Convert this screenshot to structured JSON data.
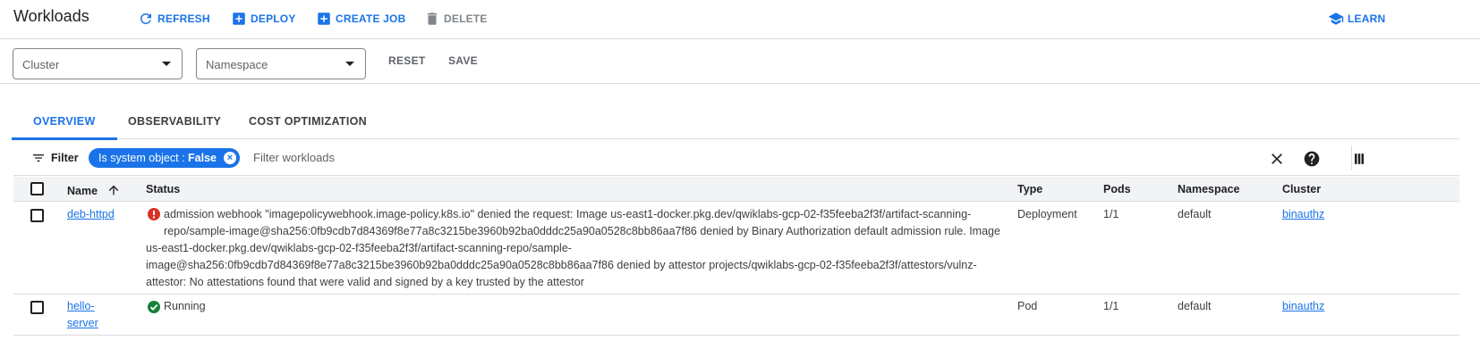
{
  "header": {
    "title": "Workloads",
    "refresh_label": "REFRESH",
    "deploy_label": "DEPLOY",
    "create_job_label": "CREATE JOB",
    "delete_label": "DELETE",
    "learn_label": "LEARN"
  },
  "filters": {
    "cluster_placeholder": "Cluster",
    "namespace_placeholder": "Namespace",
    "reset_label": "RESET",
    "save_label": "SAVE"
  },
  "tabs": [
    {
      "label": "OVERVIEW",
      "active": true
    },
    {
      "label": "OBSERVABILITY",
      "active": false
    },
    {
      "label": "COST OPTIMIZATION",
      "active": false
    }
  ],
  "filterbar": {
    "filter_label": "Filter",
    "chip_key": "Is system object : ",
    "chip_value": "False",
    "input_placeholder": "Filter workloads"
  },
  "table": {
    "columns": {
      "name": "Name",
      "status": "Status",
      "type": "Type",
      "pods": "Pods",
      "namespace": "Namespace",
      "cluster": "Cluster"
    },
    "rows": [
      {
        "name_line1": "deb-httpd",
        "name_line2": "",
        "status_lines": [
          "admission webhook \"imagepolicywebhook.image-policy.k8s.io\" denied the request: Image us-east1-docker.pkg.dev/qwiklabs-gcp-02-f35feeba2f3f/artifact-scanning-",
          "repo/sample-image@sha256:0fb9cdb7d84369f8e77a8c3215be3960b92ba0dddc25a90a0528c8bb86aa7f86 denied by Binary Authorization default admission rule. Image",
          "us-east1-docker.pkg.dev/qwiklabs-gcp-02-f35feeba2f3f/artifact-scanning-repo/sample-",
          "image@sha256:0fb9cdb7d84369f8e77a8c3215be3960b92ba0dddc25a90a0528c8bb86aa7f86 denied by attestor projects/qwiklabs-gcp-02-f35feeba2f3f/attestors/vulnz-",
          "attestor: No attestations found that were valid and signed by a key trusted by the attestor"
        ],
        "status_icon": "error-icon",
        "type": "Deployment",
        "pods": "1/1",
        "namespace": "default",
        "cluster": "binauthz"
      },
      {
        "name_line1": "hello-",
        "name_line2": "server",
        "status_lines": [
          "Running"
        ],
        "status_icon": "check-circle-icon",
        "type": "Pod",
        "pods": "1/1",
        "namespace": "default",
        "cluster": "binauthz"
      }
    ]
  },
  "colors": {
    "accent": "#1a73e8",
    "error": "#d93025",
    "success": "#188038",
    "disabled": "#80868b"
  }
}
